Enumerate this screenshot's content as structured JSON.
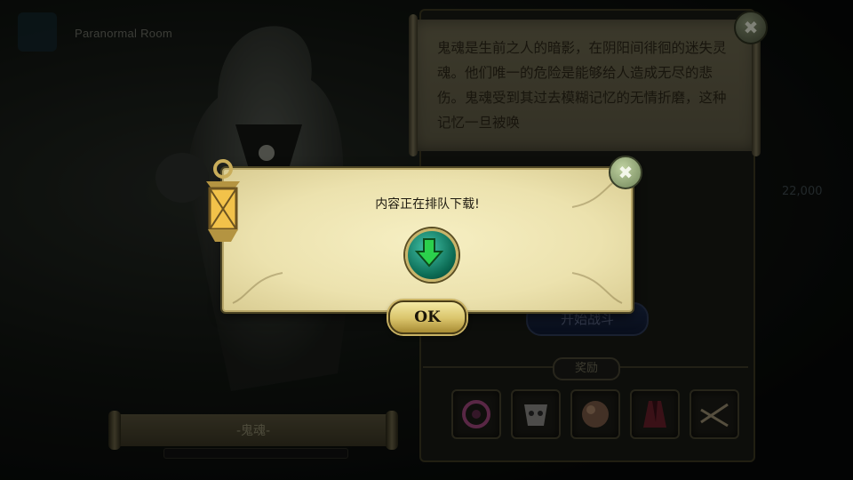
{
  "header": {
    "title": "Paranormal Room"
  },
  "lore": {
    "text": "鬼魂是生前之人的暗影，在阴阳间徘徊的迷失灵魂。他们唯一的危险是能够给人造成无尽的悲伤。鬼魂受到其过去模糊记忆的无情折磨，这种记忆一旦被唤"
  },
  "actions": {
    "start_label": "开始战斗"
  },
  "rewards": {
    "label": "奖励",
    "items": [
      "rune-icon",
      "mask-icon",
      "orb-icon",
      "cape-icon",
      "scissors-icon"
    ]
  },
  "side": {
    "counter": "22,000"
  },
  "character": {
    "name": "-鬼魂-"
  },
  "dialog": {
    "message": "内容正在排队下载!",
    "ok_label": "OK"
  },
  "colors": {
    "parchment": "#ece2ae",
    "gold": "#c8b46a",
    "download_green": "#0b6b54"
  }
}
